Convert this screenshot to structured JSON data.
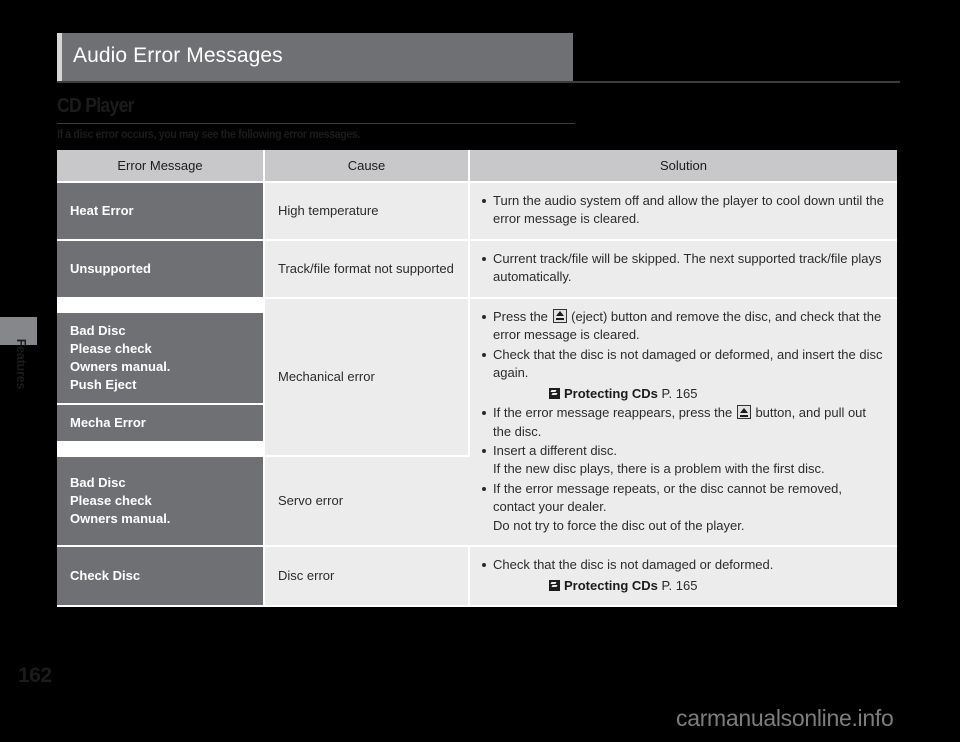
{
  "page": {
    "title": "Audio Error Messages",
    "chapter_label": "Features",
    "page_number": "162",
    "watermark": "carmanualsonline.info"
  },
  "section": {
    "heading": "CD Player",
    "intro": "If a disc error occurs, you may see the following error messages."
  },
  "table": {
    "headers": {
      "error_message": "Error Message",
      "cause": "Cause",
      "solution": "Solution"
    },
    "rows": [
      {
        "messages": [
          "Heat Error"
        ],
        "cause": "High temperature",
        "solution_bullets": [
          "Turn the audio system off and allow the player to cool down until the error message is cleared."
        ]
      },
      {
        "messages": [
          "Unsupported"
        ],
        "cause": "Track/file format not supported",
        "solution_bullets": [
          "Current track/file will be skipped. The next supported track/file plays automatically."
        ]
      },
      {
        "messages": [
          "Bad Disc\nPlease check\nOwners manual.\nPush Eject",
          "Mecha Error"
        ],
        "cause": "Mechanical error",
        "solution_bullets": [
          "Press the [eject] (eject) button and remove the disc, and check that the error message is cleared.",
          "Check that the disc is not damaged or deformed, and insert the disc again."
        ],
        "xref": {
          "icon": "jump-arrow-icon",
          "title": "Protecting CDs",
          "page": "P. 165"
        }
      },
      {
        "messages": [
          "Bad Disc\nPlease check\nOwners manual."
        ],
        "cause": "Servo error",
        "solution_bullets": [
          "If the error message reappears, press the [eject] button, and pull out the disc.",
          "Insert a different disc.\nIf the new disc plays, there is a problem with the first disc.",
          "If the error message repeats, or the disc cannot be removed, contact your dealer.\nDo not try to force the disc out of the player."
        ]
      },
      {
        "messages": [
          "Check Disc"
        ],
        "cause": "Disc error",
        "solution_bullets": [
          "Check that the disc is not damaged or deformed."
        ],
        "xref": {
          "icon": "jump-arrow-icon",
          "title": "Protecting CDs",
          "page": "P. 165"
        }
      }
    ],
    "solution_text": {
      "r1_b1": "Turn the audio system off and allow the player to cool down until the error message is cleared.",
      "r2_b1": "Current track/file will be skipped. The next supported track/file plays automatically.",
      "r3_b1_a": "Press the",
      "r3_b1_b": "(eject) button and remove the disc, and check that the error message is cleared.",
      "r3_b2": "Check that the disc is not damaged or deformed, and insert the disc again.",
      "r4_b1_a": "If the error message reappears, press the",
      "r4_b1_b": "button, and pull out the disc.",
      "r4_b2_l1": "Insert a different disc.",
      "r4_b2_l2": "If the new disc plays, there is a problem with the first disc.",
      "r4_b3_l1": "If the error message repeats, or the disc cannot be removed, contact your dealer.",
      "r4_b3_l2": "Do not try to force the disc out of the player.",
      "r5_b1": "Check that the disc is not damaged or deformed."
    },
    "messages_text": {
      "r1": "Heat Error",
      "r2": "Unsupported",
      "r3a_l1": "Bad Disc",
      "r3a_l2": "Please check",
      "r3a_l3": "Owners manual.",
      "r3a_l4": "Push Eject",
      "r3b": "Mecha Error",
      "r4_l1": "Bad Disc",
      "r4_l2": "Please check",
      "r4_l3": "Owners manual.",
      "r5": "Check Disc"
    },
    "cause_text": {
      "r1": "High temperature",
      "r2": "Track/file format not supported",
      "r3": "Mechanical error",
      "r4": "Servo error",
      "r5": "Disc error"
    },
    "xref_text": {
      "title": "Protecting CDs",
      "page": "P. 165"
    }
  }
}
